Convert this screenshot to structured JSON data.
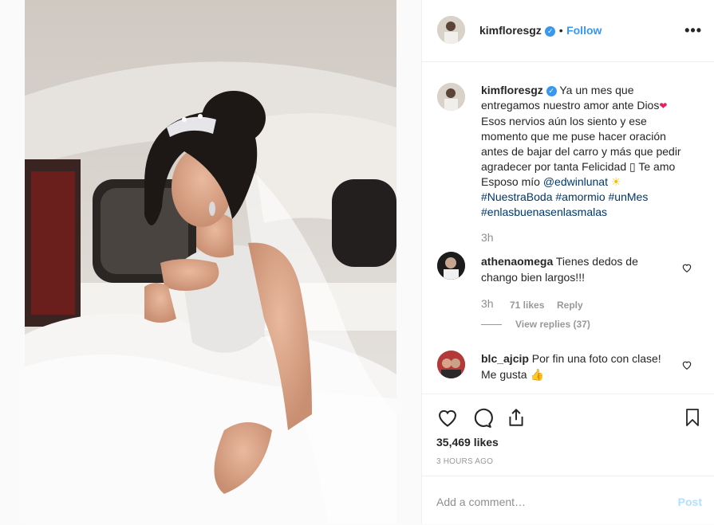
{
  "post": {
    "username": "kimfloresgz",
    "verified_badge": "✓",
    "separator": "•",
    "follow_label": "Follow",
    "more_label": "•••",
    "caption_username": "kimfloresgz",
    "caption_part1": " Ya un mes que entregamos nuestro amor ante Dios",
    "caption_heart": "❤",
    "caption_part2": " Esos nervios aún los siento y ese momento que me puse hacer oración antes de bajar del carro y más que pedir agradecer por tanta Felicidad ",
    "caption_missing_glyph": "▯",
    "caption_part3": " Te amo Esposo mío ",
    "caption_mention": "@edwinlunat",
    "caption_sun": "☀",
    "caption_tags": "#NuestraBoda #amormio #unMes #enlasbuenasenlasmalas",
    "caption_time": "3h"
  },
  "comments": [
    {
      "username": "athenaomega",
      "text": " Tienes dedos de chango bien largos!!!",
      "time": "3h",
      "likes": "71 likes",
      "reply": "Reply",
      "view_replies": "View replies (37)"
    },
    {
      "username": "blc_ajcip",
      "text": " Por fin una foto con clase! Me gusta ",
      "emoji": "👍"
    }
  ],
  "actions": {
    "likes": "35,469 likes",
    "timestamp": "3 HOURS AGO",
    "icons": [
      "heart-icon",
      "comment-icon",
      "share-icon",
      "bookmark-icon"
    ]
  },
  "add_comment": {
    "placeholder": "Add a comment…",
    "post_label": "Post"
  },
  "colors": {
    "link": "#00376b",
    "accent": "#3897f0",
    "post_disabled": "#b2dffc"
  }
}
